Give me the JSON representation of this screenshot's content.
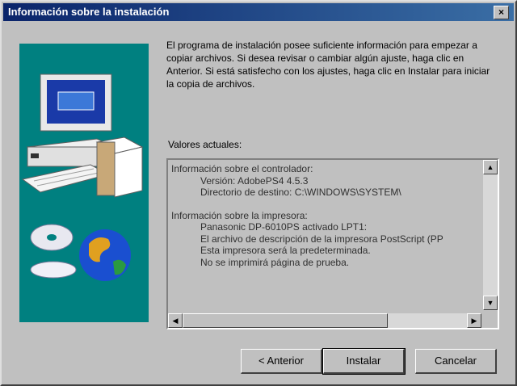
{
  "window": {
    "title": "Información sobre la instalación",
    "close_label": "×"
  },
  "intro_text": "El programa de instalación posee suficiente información para empezar a copiar archivos. Si desea revisar o cambiar algún ajuste, haga clic en Anterior. Si está satisfecho con los ajustes, haga clic en Instalar para iniciar la copia de archivos.",
  "current_values_label": "Valores actuales:",
  "listbox": {
    "driver_heading": "Información sobre el controlador:",
    "driver_version": "Versión: AdobePS4 4.5.3",
    "driver_dir": "Directorio de destino: C:\\WINDOWS\\SYSTEM\\",
    "printer_heading": "Información sobre la impresora:",
    "printer_name": "Panasonic DP-6010PS activado LPT1:",
    "printer_ppd": "El archivo de descripción de la impresora PostScript (PP",
    "printer_default": "Esta impresora será la predeterminada.",
    "printer_testpage": "No se imprimirá página de prueba."
  },
  "scrollbar_arrows": {
    "up": "▲",
    "down": "▼",
    "left": "◀",
    "right": "▶"
  },
  "buttons": {
    "back": "< Anterior",
    "install": "Instalar",
    "cancel": "Cancelar"
  },
  "colors": {
    "dialog": "#c0c0c0",
    "title_bar": "#0a246a",
    "art_background": "#008080"
  }
}
